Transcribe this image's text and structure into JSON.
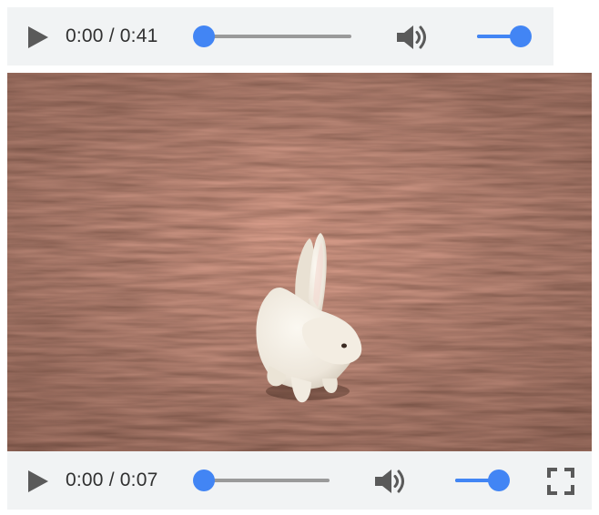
{
  "audio_player": {
    "current_time": "0:00",
    "duration": "0:41",
    "time_text": "0:00 / 0:41",
    "seek_progress": 0.0,
    "volume_level": 1.0,
    "icons": {
      "play": "play-icon",
      "volume": "volume-icon"
    }
  },
  "video_player": {
    "content": "white rabbit figurine on a wooden surface",
    "current_time": "0:00",
    "duration": "0:07",
    "time_text": "0:00 / 0:07",
    "seek_progress": 0.0,
    "volume_level": 1.0,
    "icons": {
      "play": "play-icon",
      "volume": "volume-icon",
      "fullscreen": "fullscreen-icon"
    }
  },
  "colors": {
    "accent": "#4285f4",
    "control_bar_bg": "#f1f3f4",
    "track": "#9a9a9a",
    "icon": "#5a5a5a"
  }
}
